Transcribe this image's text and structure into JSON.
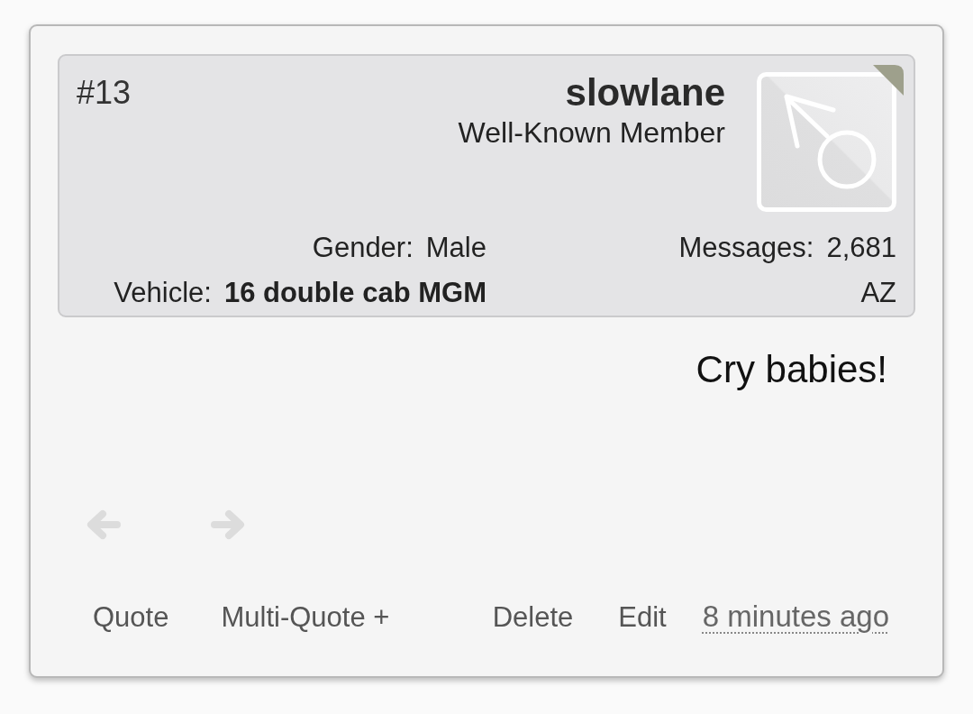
{
  "post": {
    "post_number": "#13",
    "author": {
      "name": "slowlane",
      "title": "Well-Known Member"
    },
    "stats": [
      {
        "label": "Gender:",
        "value": "Male",
        "emphasis": false
      },
      {
        "label": "Messages:",
        "value": "2,681",
        "emphasis": false
      },
      {
        "label": "Vehicle:",
        "value": "16 double cab MGM",
        "emphasis": true
      },
      {
        "value": "AZ",
        "emphasis": false
      }
    ],
    "message": "Cry babies!",
    "quote_actions": [
      "Quote",
      "Multi-Quote +"
    ],
    "owner_actions": [
      "Delete",
      "Edit"
    ],
    "date": "8 minutes ago"
  }
}
